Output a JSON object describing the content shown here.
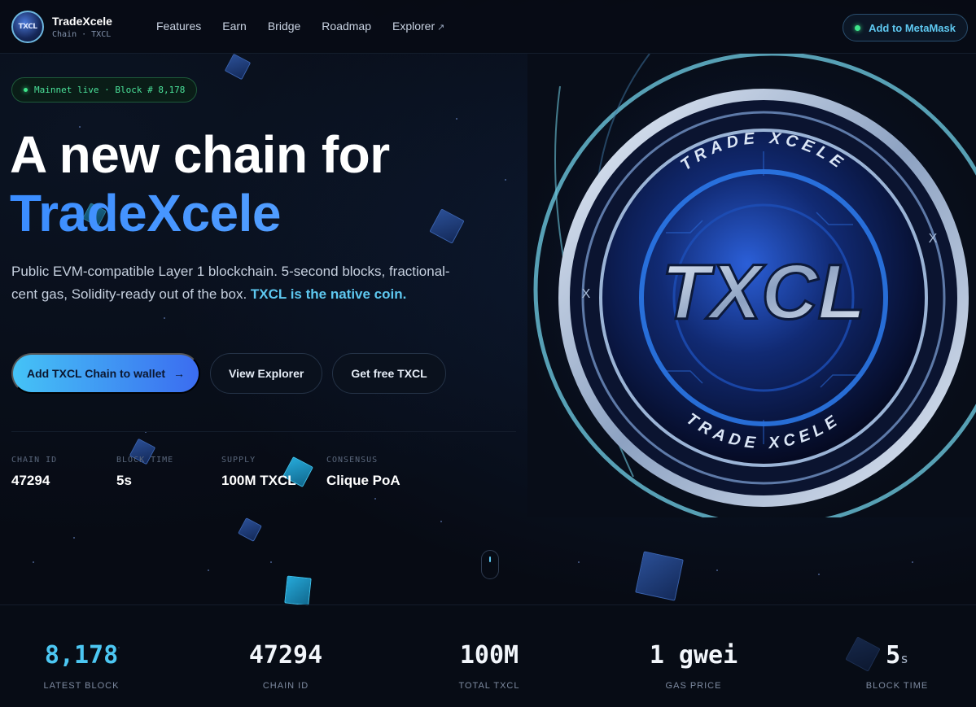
{
  "brand": {
    "name": "TradeXcele",
    "subtitle": "Chain · TXCL",
    "logo_text": "TXCL"
  },
  "nav": {
    "links": [
      "Features",
      "Earn",
      "Bridge",
      "Roadmap",
      "Explorer"
    ],
    "explorer_ext_icon": "↗",
    "metamask_button": "Add to MetaMask"
  },
  "hero": {
    "status_pill": "Mainnet live · Block # 8,178",
    "title_line1": "A new chain for",
    "title_line2": "TradeXcele",
    "description": "Public EVM-compatible Layer 1 blockchain. 5-second blocks, fractional-cent gas, Solidity-ready out of the box.",
    "description_highlight": "TXCL is the native coin.",
    "buttons": {
      "primary": "Add TXCL Chain to wallet",
      "primary_icon": "→",
      "explorer": "View Explorer",
      "faucet": "Get free TXCL"
    },
    "facts": [
      {
        "label": "CHAIN ID",
        "value": "47294"
      },
      {
        "label": "BLOCK TIME",
        "value": "5s"
      },
      {
        "label": "SUPPLY",
        "value": "100M TXCL"
      },
      {
        "label": "CONSENSUS",
        "value": "Clique PoA"
      }
    ]
  },
  "coin": {
    "ring_text_top": "TRADE XCELE",
    "ring_text_bottom": "TRADE XCELE",
    "center_text": "TXCL",
    "side_mark": "X"
  },
  "stats": [
    {
      "value": "8,178",
      "unit": "",
      "label": "LATEST BLOCK"
    },
    {
      "value": "47294",
      "unit": "",
      "label": "CHAIN ID"
    },
    {
      "value": "100M",
      "unit": "",
      "label": "TOTAL TXCL"
    },
    {
      "value": "1 gwei",
      "unit": "",
      "label": "GAS PRICE"
    },
    {
      "value": "5",
      "unit": "s",
      "label": "BLOCK TIME"
    }
  ],
  "colors": {
    "background": "#070b14",
    "accent_cyan": "#4cc7f2",
    "accent_blue": "#3a8cff",
    "status_green": "#3ee58a"
  }
}
